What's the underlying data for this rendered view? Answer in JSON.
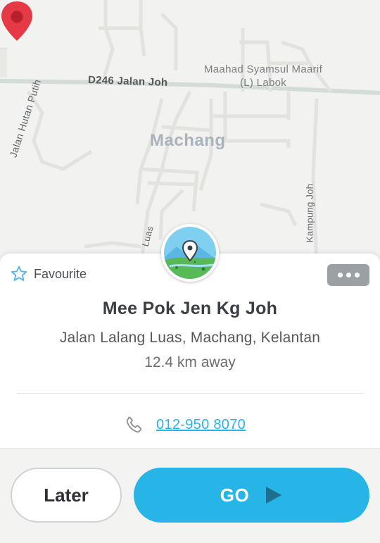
{
  "map": {
    "road_d246": "D246 Jalan Joh",
    "school_line1": "Maahad Syamsul Maarif",
    "school_line2": "(L) Labok",
    "town": "Machang",
    "road_hutan": "Jalan Hutan Putih",
    "road_kampung": "Kampung Joh",
    "road_luas": "Luas"
  },
  "card": {
    "favourite_label": "Favourite",
    "title": "Mee Pok Jen Kg Joh",
    "address": "Jalan Lalang Luas, Machang, Kelantan",
    "distance": "12.4 km away",
    "phone": "012-950 8070"
  },
  "actions": {
    "later_label": "Later",
    "go_label": "GO"
  },
  "icons": {
    "pin": "map-pin-icon",
    "favourite": "star-outline-icon",
    "more": "more-dots-icon",
    "phone": "phone-icon",
    "go": "play-arrow-icon"
  },
  "colors": {
    "accent": "#27b4e6",
    "pin": "#e53946",
    "star": "#5ab7e8"
  }
}
